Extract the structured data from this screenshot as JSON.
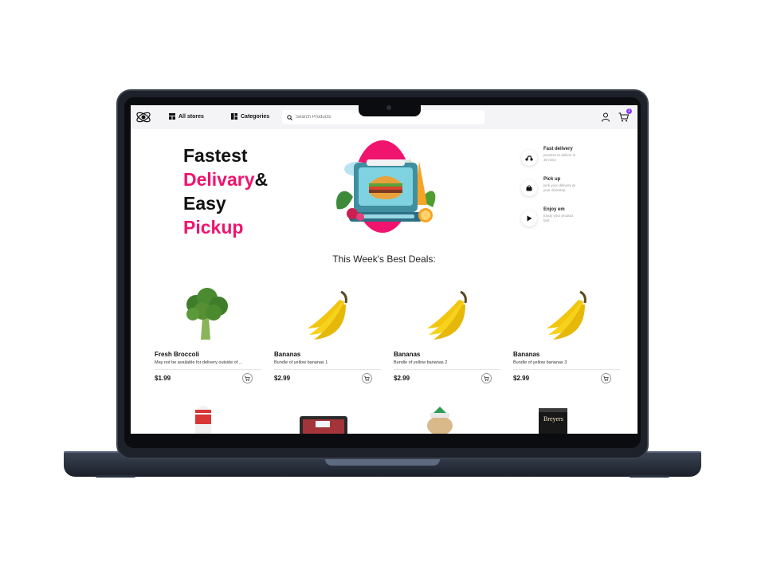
{
  "header": {
    "all_stores": "All stores",
    "categories": "Categories",
    "search_placeholder": "Search Products",
    "cart_count": "1"
  },
  "hero": {
    "line1": "Fastest",
    "line2_pink": "Delivary",
    "line2_rest": "&",
    "line3": "Easy",
    "line4_pink": "Pickup"
  },
  "features": [
    {
      "title": "Fast delivery",
      "desc": "promise to deliver in 30 mins",
      "icon": "scooter-icon"
    },
    {
      "title": "Pick up",
      "desc": "pick your delivery at your doorstep",
      "icon": "bag-icon"
    },
    {
      "title": "Enjoy em",
      "desc": "Enjoy your product fast",
      "icon": "play-icon"
    }
  ],
  "deals_title": "This Week's Best Deals:",
  "products": [
    {
      "name": "Fresh Broccoli",
      "desc": "May not be available for delivery outside of ...",
      "price": "$1.99",
      "image": "broccoli-image"
    },
    {
      "name": "Bananas",
      "desc": "Bundle of yellow bananas 1",
      "price": "$2.99",
      "image": "banana-image"
    },
    {
      "name": "Bananas",
      "desc": "Bundle of yellow bananas 2",
      "price": "$2.99",
      "image": "banana-image"
    },
    {
      "name": "Bananas",
      "desc": "Bundle of yellow bananas 3",
      "price": "$2.99",
      "image": "banana-image"
    }
  ],
  "colors": {
    "accent": "#f0146e",
    "badge": "#8b3cf2"
  }
}
